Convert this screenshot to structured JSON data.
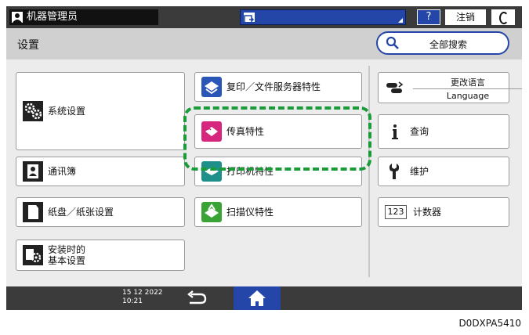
{
  "topbar": {
    "user_label": "机器管理员",
    "help_label": "?",
    "logout_label": "注销"
  },
  "titlebar": {
    "title": "设置",
    "search_label": "全部搜索"
  },
  "tiles": {
    "system_settings": "系统设置",
    "copy_doc_server": "复印／文件服务器特性",
    "fax": "传真特性",
    "address_book": "通讯簿",
    "printer": "打印机特性",
    "tray_paper": "纸盘／纸张设置",
    "scanner": "扫描仪特性",
    "initial_line1": "安装时的",
    "initial_line2": "基本设置",
    "change_language": "更改语言",
    "language": "Language",
    "inquiry": "查询",
    "maintenance": "维护",
    "counter": "计数器",
    "counter_icon_text": "123"
  },
  "bottombar": {
    "date": "15 12 2022",
    "time": "10:21"
  },
  "figure_code": "D0DXPA5410",
  "colors": {
    "accent_blue": "#2446a8",
    "highlight_green": "#1a9b3a",
    "fax_magenta": "#d6267e",
    "scanner_green": "#3aa335",
    "copy_blue": "#2a56b8",
    "printer_teal": "#1f8f8a"
  }
}
